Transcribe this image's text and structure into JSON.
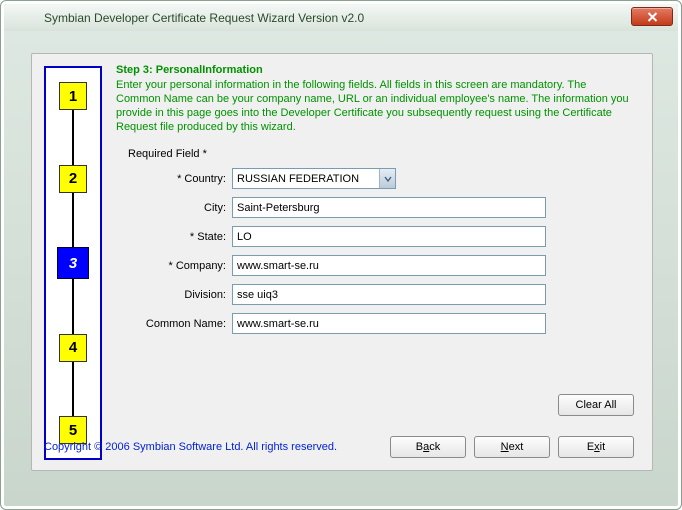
{
  "window": {
    "title": "Symbian Developer Certificate Request Wizard Version v2.0"
  },
  "steps": {
    "labels": [
      "1",
      "2",
      "3",
      "4",
      "5"
    ],
    "active_index": 2
  },
  "content": {
    "step_title": "Step 3: PersonalInformation",
    "instructions": "Enter your personal information in the following fields. All fields in this screen are mandatory. The Common Name can be your company name, URL or an individual employee's name. The information you provide in this page goes into the Developer Certificate you subsequently request using the Certificate Request file produced by this wizard.",
    "required_label": "Required Field *",
    "fields": {
      "country": {
        "label": "* Country:",
        "value": "RUSSIAN FEDERATION"
      },
      "city": {
        "label": "City:",
        "value": "Saint-Petersburg"
      },
      "state": {
        "label": "* State:",
        "value": "LO"
      },
      "company": {
        "label": "* Company:",
        "value": "www.smart-se.ru"
      },
      "division": {
        "label": "Division:",
        "value": "sse uiq3"
      },
      "common_name": {
        "label": "Common Name:",
        "value": "www.smart-se.ru"
      }
    },
    "clear_all": "Clear All"
  },
  "footer": {
    "copyright": "Copyright © 2006 Symbian Software Ltd. All rights reserved.",
    "back_prefix": "B",
    "back_u": "a",
    "back_suffix": "ck",
    "next_u": "N",
    "next_suffix": "ext",
    "exit_prefix": "E",
    "exit_u": "x",
    "exit_suffix": "it"
  }
}
